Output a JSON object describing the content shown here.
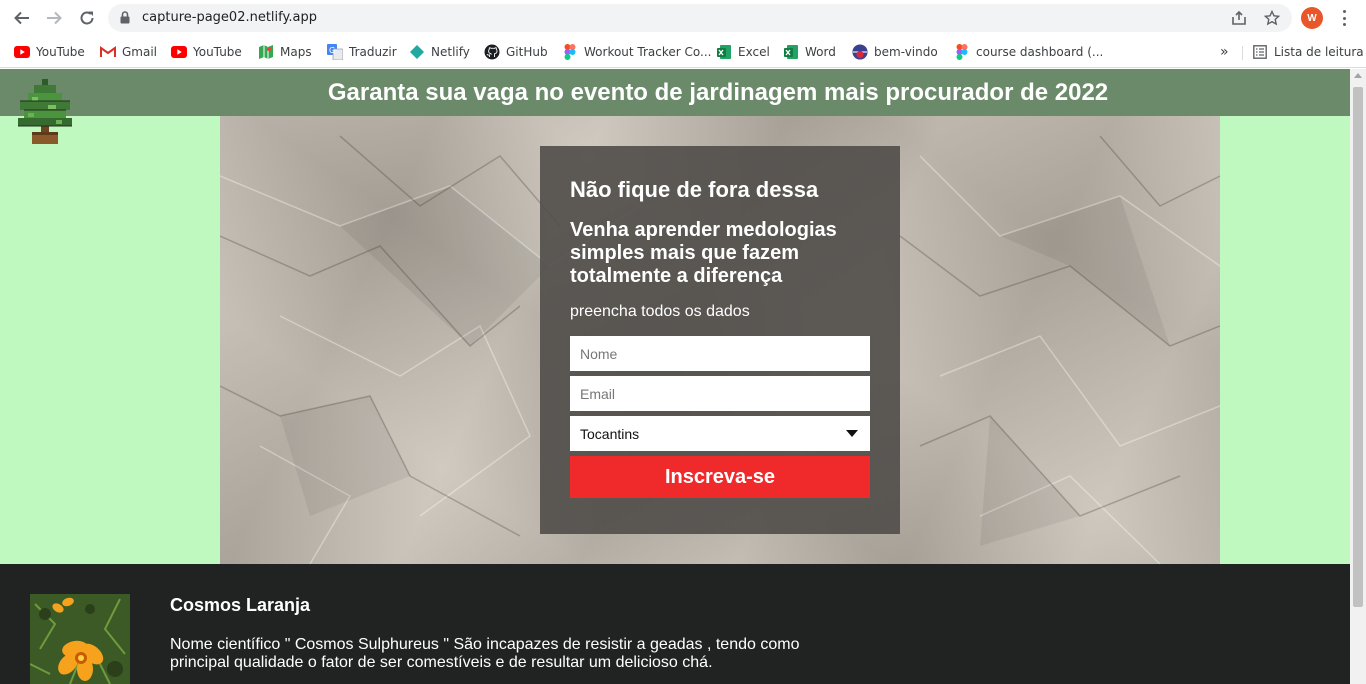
{
  "browser": {
    "url": "capture-page02.netlify.app",
    "profile_initial": "W",
    "bookmarks": [
      {
        "label": "YouTube",
        "icon": "youtube-icon"
      },
      {
        "label": "Gmail",
        "icon": "gmail-icon"
      },
      {
        "label": "YouTube",
        "icon": "youtube-icon"
      },
      {
        "label": "Maps",
        "icon": "maps-icon"
      },
      {
        "label": "Traduzir",
        "icon": "translate-icon"
      },
      {
        "label": "Netlify",
        "icon": "netlify-icon"
      },
      {
        "label": "GitHub",
        "icon": "github-icon"
      },
      {
        "label": "Workout Tracker Co...",
        "icon": "figma-icon"
      },
      {
        "label": "Excel",
        "icon": "excel-icon"
      },
      {
        "label": "Word",
        "icon": "excel-icon"
      },
      {
        "label": "bem-vindo",
        "icon": "site-icon"
      },
      {
        "label": "course dashboard (...",
        "icon": "figma-icon"
      }
    ],
    "more_bookmarks": "»",
    "reading_list": "Lista de leitura"
  },
  "page": {
    "header_title": "Garanta sua vaga no evento de jardinagem mais procurador de 2022",
    "form": {
      "title": "Não fique de fora dessa",
      "subtitle": "Venha aprender medologias simples mais que fazem totalmente a diferença",
      "hint": "preencha todos os dados",
      "name_placeholder": "Nome",
      "email_placeholder": "Email",
      "state_selected": "Tocantins",
      "submit_label": "Inscreva-se"
    },
    "footer": {
      "flower_title": "Cosmos Laranja",
      "flower_description": "Nome científico \" Cosmos Sulphureus \" São incapazes de resistir a geadas , tendo como principal qualidade o fator de ser comestíveis e de resultar um delicioso chá."
    }
  },
  "colors": {
    "header_bg": "#6a8a6a",
    "page_bg": "#bff9bf",
    "form_bg": "#504d49",
    "submit_bg": "#f0292a",
    "footer_bg": "#212222",
    "profile_avatar": "#e8562a"
  }
}
